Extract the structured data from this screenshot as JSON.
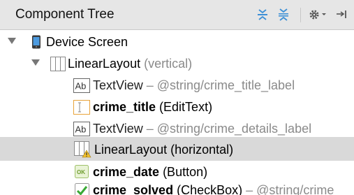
{
  "panel": {
    "title": "Component Tree"
  },
  "toolbar": {
    "icons": [
      "expand-all-icon",
      "collapse-all-icon",
      "gear-icon",
      "hide-panel-icon"
    ]
  },
  "tree": {
    "rows": [
      {
        "name": "Device Screen",
        "suffix": "",
        "detail": ""
      },
      {
        "name": "LinearLayout",
        "suffix": "",
        "detail": "(vertical)"
      },
      {
        "name": "TextView",
        "suffix": "",
        "detail": " – @string/crime_title_label"
      },
      {
        "name": "crime_title",
        "suffix": " (EditText)",
        "detail": ""
      },
      {
        "name": "TextView",
        "suffix": "",
        "detail": " – @string/crime_details_label"
      },
      {
        "name": "LinearLayout (horizontal)",
        "suffix": "",
        "detail": ""
      },
      {
        "name": "crime_date",
        "suffix": " (Button)",
        "detail": ""
      },
      {
        "name": "crime_solved",
        "suffix": " (CheckBox)",
        "detail": " – @string/crime"
      }
    ],
    "selected_index": 5
  },
  "colors": {
    "header_bg": "#e6e6e6",
    "selected_bg": "#d9d9d9",
    "detail_text": "#8a8a8a",
    "toolbar_icon": "#3c8fd6"
  }
}
